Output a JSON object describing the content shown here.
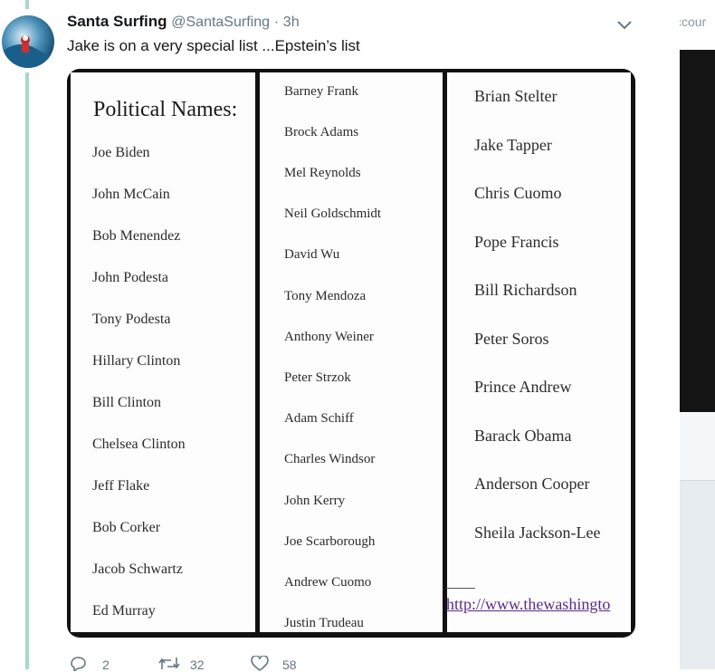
{
  "tweet": {
    "display_name": "Santa Surfing",
    "handle": "@SantaSurfing",
    "separator": "·",
    "time": "3h",
    "text": "Jake is on a very special list ...Epstein’s list"
  },
  "side_panel": {
    "text": "ccour"
  },
  "image": {
    "title": "Political Names:",
    "column1": [
      "Joe Biden",
      "John McCain",
      "Bob Menendez",
      "John Podesta",
      "Tony Podesta",
      "Hillary Clinton",
      "Bill Clinton",
      "Chelsea Clinton",
      "Jeff Flake",
      "Bob Corker",
      "Jacob Schwartz",
      "Ed Murray"
    ],
    "column2": [
      "Barney Frank",
      "Brock Adams",
      "Mel Reynolds",
      "Neil Goldschmidt",
      "David Wu",
      "Tony Mendoza",
      "Anthony Weiner",
      "Peter Strzok",
      "Adam Schiff",
      "Charles Windsor",
      "John Kerry",
      "Joe Scarborough",
      "Andrew Cuomo",
      "Justin Trudeau"
    ],
    "column3": [
      "Brian Stelter",
      "Jake Tapper",
      "Chris Cuomo",
      "Pope Francis",
      "Bill Richardson",
      "Peter Soros",
      "Prince Andrew",
      "Barack Obama",
      "Anderson Cooper",
      "Sheila Jackson-Lee"
    ],
    "link": "http://www.thewashingto"
  },
  "actions": {
    "replies": "2",
    "retweets": "32",
    "likes": "58"
  },
  "icons": {
    "reply": "reply-icon",
    "retweet": "retweet-icon",
    "like": "heart-icon",
    "menu": "chevron-down-icon"
  },
  "colors": {
    "thread_line": "#a8d9c8",
    "secondary_text": "#657786",
    "link": "#5a2a8a"
  }
}
